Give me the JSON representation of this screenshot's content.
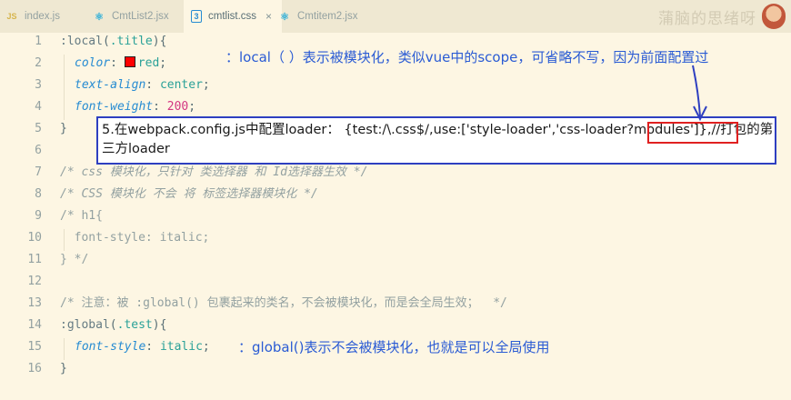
{
  "tabs": [
    {
      "label": "index.js",
      "icon": "js-file-icon",
      "glyph": "JS",
      "active": false,
      "color": "#d6b44c"
    },
    {
      "label": "CmtList2.jsx",
      "icon": "react-file-icon",
      "glyph": "⚛",
      "active": false,
      "color": "#38b2d8"
    },
    {
      "label": "cmtlist.css",
      "icon": "css-file-icon",
      "glyph": "3",
      "active": true,
      "close": "×",
      "color": "#268bd2"
    },
    {
      "label": "Cmtitem2.jsx",
      "icon": "react-file-icon",
      "glyph": "⚛",
      "active": false,
      "color": "#38b2d8"
    }
  ],
  "watermark": "蒲脑的思绪呀",
  "code": {
    "line_numbers": [
      "1",
      "2",
      "3",
      "4",
      "5",
      "6",
      "7",
      "8",
      "9",
      "10",
      "11",
      "12",
      "13",
      "14",
      "15",
      "16"
    ],
    "l1": {
      "selector": ":local",
      "paren_open": "(",
      "arg": ".title",
      "paren_close": "){"
    },
    "l2": {
      "prop": "color",
      "colon": ":",
      "swatch_color": "#ff0000",
      "value": "red",
      "semi": ";"
    },
    "l3": {
      "prop": "text-align",
      "colon": ":",
      "value": "center",
      "semi": ";"
    },
    "l4": {
      "prop": "font-weight",
      "colon": ":",
      "value": "200",
      "semi": ";"
    },
    "l5": "}",
    "l7": "/* css 模块化，只针对 类选择器 和 Id选择器生效 */",
    "l8": "/* CSS 模块化 不会 将 标签选择器模块化 */",
    "l9": "/* h1{",
    "l10": "  font-style: italic;",
    "l11": "} */",
    "l13": "/* 注意：被 :global() 包裹起来的类名，不会被模块化，而是会全局生效；  */",
    "l14": {
      "selector": ":global",
      "paren_open": "(",
      "arg": ".test",
      "paren_close": "){"
    },
    "l15": {
      "prop": "font-style",
      "colon": ":",
      "value": "italic",
      "semi": ";"
    },
    "l16": "}"
  },
  "annotations": {
    "local_note": "：local（ ）表示被模块化，类似vue中的scope，可省略不写，因为前面配置过",
    "loader_note": "5.在webpack.config.js中配置loader：  {test:/\\.css$/,use:['style-loader','css-loader?modules']},//打包的第三方loader",
    "global_note": "：global()表示不会被模块化，也就是可以全局使用"
  },
  "colors": {
    "annotation_blue": "#2a5bd4",
    "box_border": "#2e3fc0",
    "highlight_red": "#e02020",
    "arrow": "#2e3fc0"
  }
}
